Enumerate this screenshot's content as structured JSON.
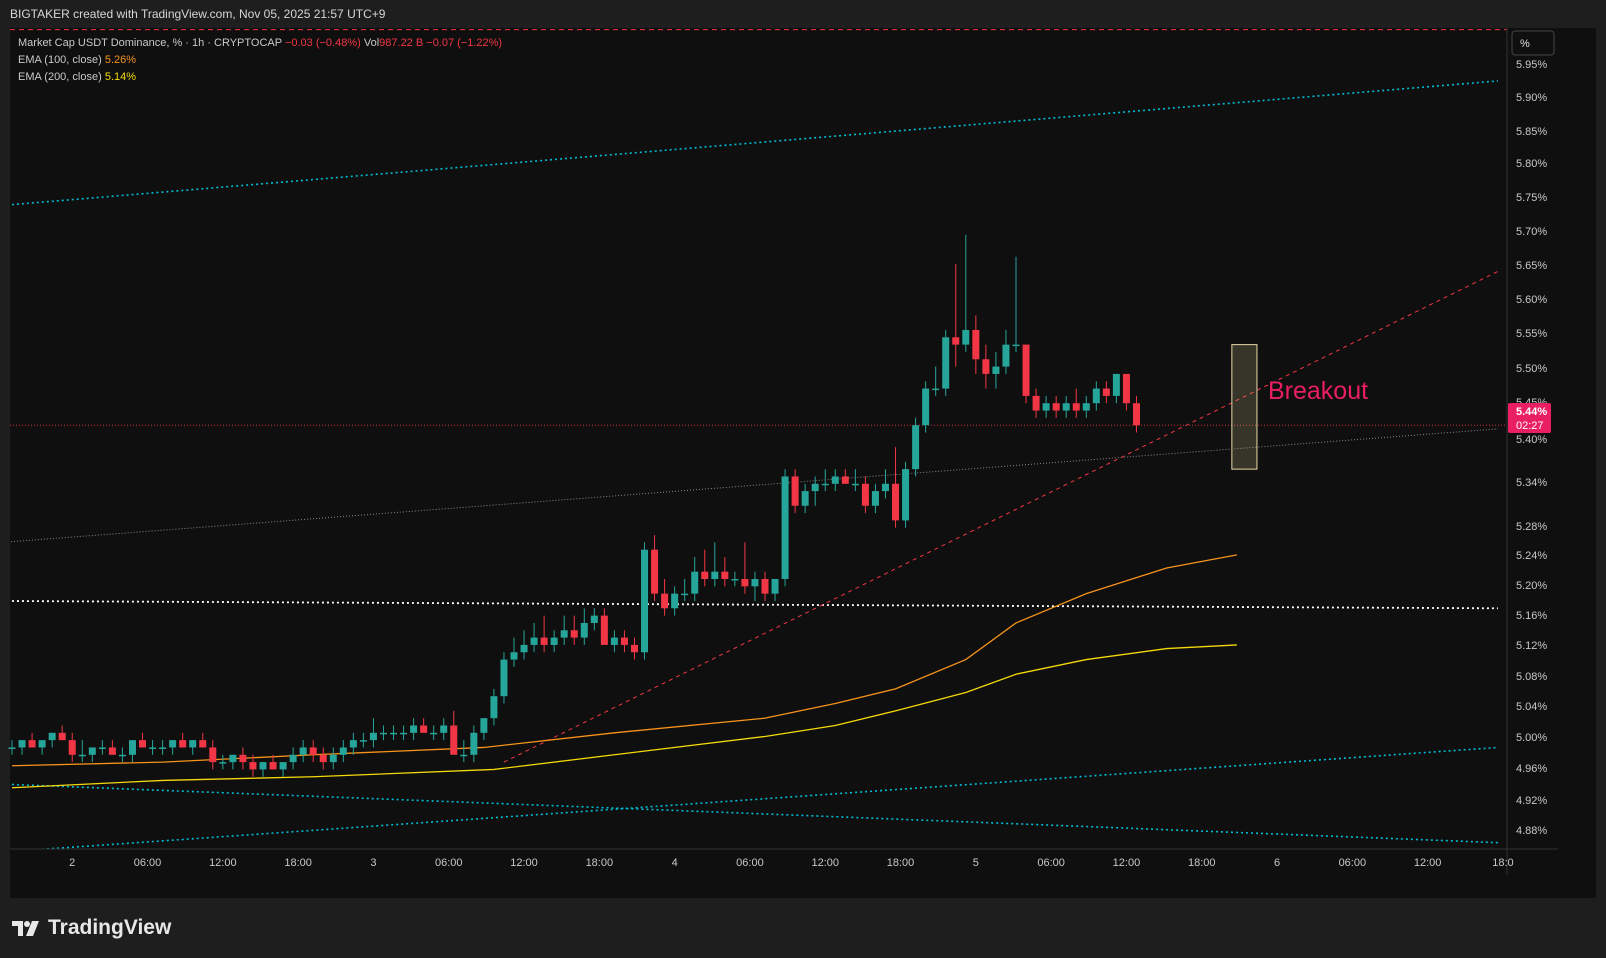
{
  "header": {
    "attribution": "BIGTAKER created with TradingView.com, Nov 05, 2025 21:57 UTC+9"
  },
  "legend": {
    "symbol": "Market Cap USDT Dominance, % · 1h · CRYPTOCAP",
    "change": "−0.03 (−0.48%)",
    "vol_label": "Vol",
    "vol_value": "987.22 B",
    "vol_change": "−0.07 (−1.22%)",
    "ema100_label": "EMA (100, close)",
    "ema100_value": "5.26%",
    "ema200_label": "EMA (200, close)",
    "ema200_value": "5.14%"
  },
  "colors": {
    "up": "#26a69a",
    "down": "#f23645",
    "ema100": "#f7931a",
    "ema200": "#f5d90a",
    "channel": "#00bcd4",
    "label": "#e91e63"
  },
  "price_axis": {
    "unit_label": "%",
    "ticks": [
      "5.95%",
      "5.90%",
      "5.85%",
      "5.80%",
      "5.75%",
      "5.70%",
      "5.65%",
      "5.60%",
      "5.55%",
      "5.50%",
      "5.45%",
      "5.40%",
      "5.34%",
      "5.28%",
      "5.24%",
      "5.20%",
      "5.16%",
      "5.12%",
      "5.08%",
      "5.04%",
      "5.00%",
      "4.96%",
      "4.92%",
      "4.88%"
    ],
    "current_price": "5.44%",
    "countdown": "02:27"
  },
  "time_axis": {
    "ticks": [
      "2",
      "06:00",
      "12:00",
      "18:00",
      "3",
      "06:00",
      "12:00",
      "18:00",
      "4",
      "06:00",
      "12:00",
      "18:00",
      "5",
      "06:00",
      "12:00",
      "18:00",
      "6",
      "06:00",
      "12:00",
      "18:0"
    ]
  },
  "annotation": {
    "text": "Breakout"
  },
  "brand": {
    "name": "TradingView"
  },
  "chart_data": {
    "type": "candlestick",
    "timeframe": "1h",
    "candles": [
      [
        5.0,
        5.01,
        4.99,
        5.0
      ],
      [
        5.0,
        5.01,
        4.99,
        5.01
      ],
      [
        5.01,
        5.02,
        5.0,
        5.0
      ],
      [
        5.0,
        5.01,
        4.99,
        5.01
      ],
      [
        5.01,
        5.02,
        5.0,
        5.02
      ],
      [
        5.02,
        5.03,
        5.01,
        5.01
      ],
      [
        5.01,
        5.02,
        4.98,
        4.99
      ],
      [
        4.99,
        5.01,
        4.98,
        4.99
      ],
      [
        4.99,
        5.0,
        4.98,
        5.0
      ],
      [
        5.0,
        5.01,
        4.99,
        5.0
      ],
      [
        5.0,
        5.01,
        4.99,
        4.99
      ],
      [
        4.99,
        5.0,
        4.98,
        4.99
      ],
      [
        4.99,
        5.01,
        4.98,
        5.01
      ],
      [
        5.01,
        5.02,
        5.0,
        5.0
      ],
      [
        5.0,
        5.01,
        4.99,
        5.0
      ],
      [
        5.0,
        5.01,
        4.99,
        5.0
      ],
      [
        5.0,
        5.01,
        4.99,
        5.01
      ],
      [
        5.01,
        5.02,
        5.0,
        5.0
      ],
      [
        5.0,
        5.01,
        4.99,
        5.01
      ],
      [
        5.01,
        5.02,
        5.0,
        5.0
      ],
      [
        5.0,
        5.01,
        4.97,
        4.98
      ],
      [
        4.98,
        4.99,
        4.97,
        4.98
      ],
      [
        4.98,
        4.99,
        4.97,
        4.99
      ],
      [
        4.99,
        5.0,
        4.97,
        4.98
      ],
      [
        4.98,
        4.99,
        4.96,
        4.97
      ],
      [
        4.97,
        4.98,
        4.96,
        4.98
      ],
      [
        4.98,
        4.99,
        4.97,
        4.97
      ],
      [
        4.97,
        4.98,
        4.96,
        4.98
      ],
      [
        4.98,
        5.0,
        4.97,
        4.99
      ],
      [
        4.99,
        5.01,
        4.98,
        5.0
      ],
      [
        5.0,
        5.01,
        4.98,
        4.99
      ],
      [
        4.99,
        5.0,
        4.97,
        4.98
      ],
      [
        4.98,
        5.0,
        4.97,
        4.99
      ],
      [
        4.99,
        5.01,
        4.98,
        5.0
      ],
      [
        5.0,
        5.02,
        4.99,
        5.01
      ],
      [
        5.01,
        5.02,
        5.0,
        5.01
      ],
      [
        5.01,
        5.04,
        5.0,
        5.02
      ],
      [
        5.02,
        5.03,
        5.01,
        5.02
      ],
      [
        5.02,
        5.03,
        5.01,
        5.02
      ],
      [
        5.02,
        5.03,
        5.01,
        5.02
      ],
      [
        5.02,
        5.04,
        5.01,
        5.03
      ],
      [
        5.03,
        5.04,
        5.02,
        5.02
      ],
      [
        5.02,
        5.03,
        5.01,
        5.02
      ],
      [
        5.02,
        5.04,
        5.01,
        5.03
      ],
      [
        5.03,
        5.05,
        5.02,
        4.99
      ],
      [
        4.99,
        5.01,
        4.98,
        4.99
      ],
      [
        4.99,
        5.03,
        4.98,
        5.02
      ],
      [
        5.02,
        5.04,
        5.01,
        5.04
      ],
      [
        5.04,
        5.08,
        5.03,
        5.07
      ],
      [
        5.07,
        5.13,
        5.06,
        5.12
      ],
      [
        5.12,
        5.15,
        5.11,
        5.13
      ],
      [
        5.13,
        5.16,
        5.12,
        5.14
      ],
      [
        5.14,
        5.17,
        5.13,
        5.15
      ],
      [
        5.15,
        5.18,
        5.13,
        5.14
      ],
      [
        5.14,
        5.16,
        5.13,
        5.15
      ],
      [
        5.15,
        5.18,
        5.14,
        5.16
      ],
      [
        5.16,
        5.18,
        5.14,
        5.15
      ],
      [
        5.15,
        5.19,
        5.14,
        5.17
      ],
      [
        5.17,
        5.19,
        5.16,
        5.18
      ],
      [
        5.18,
        5.19,
        5.16,
        5.14
      ],
      [
        5.14,
        5.16,
        5.13,
        5.15
      ],
      [
        5.15,
        5.16,
        5.13,
        5.14
      ],
      [
        5.14,
        5.15,
        5.12,
        5.13
      ],
      [
        5.13,
        5.28,
        5.12,
        5.27
      ],
      [
        5.27,
        5.29,
        5.2,
        5.21
      ],
      [
        5.21,
        5.23,
        5.18,
        5.19
      ],
      [
        5.19,
        5.22,
        5.18,
        5.21
      ],
      [
        5.21,
        5.23,
        5.2,
        5.21
      ],
      [
        5.21,
        5.26,
        5.2,
        5.24
      ],
      [
        5.24,
        5.27,
        5.22,
        5.23
      ],
      [
        5.23,
        5.28,
        5.22,
        5.24
      ],
      [
        5.24,
        5.26,
        5.22,
        5.23
      ],
      [
        5.23,
        5.24,
        5.22,
        5.23
      ],
      [
        5.23,
        5.28,
        5.21,
        5.22
      ],
      [
        5.22,
        5.24,
        5.2,
        5.23
      ],
      [
        5.23,
        5.24,
        5.2,
        5.21
      ],
      [
        5.21,
        5.23,
        5.2,
        5.23
      ],
      [
        5.23,
        5.38,
        5.22,
        5.37
      ],
      [
        5.37,
        5.38,
        5.32,
        5.33
      ],
      [
        5.33,
        5.36,
        5.32,
        5.35
      ],
      [
        5.35,
        5.37,
        5.33,
        5.36
      ],
      [
        5.36,
        5.38,
        5.35,
        5.36
      ],
      [
        5.36,
        5.38,
        5.35,
        5.37
      ],
      [
        5.37,
        5.38,
        5.36,
        5.36
      ],
      [
        5.36,
        5.38,
        5.35,
        5.36
      ],
      [
        5.36,
        5.37,
        5.32,
        5.33
      ],
      [
        5.33,
        5.36,
        5.32,
        5.35
      ],
      [
        5.35,
        5.38,
        5.34,
        5.36
      ],
      [
        5.36,
        5.41,
        5.3,
        5.31
      ],
      [
        5.31,
        5.39,
        5.3,
        5.38
      ],
      [
        5.38,
        5.45,
        5.37,
        5.44
      ],
      [
        5.44,
        5.5,
        5.43,
        5.49
      ],
      [
        5.49,
        5.52,
        5.48,
        5.49
      ],
      [
        5.49,
        5.57,
        5.48,
        5.56
      ],
      [
        5.56,
        5.66,
        5.52,
        5.55
      ],
      [
        5.55,
        5.7,
        5.54,
        5.57
      ],
      [
        5.57,
        5.59,
        5.51,
        5.53
      ],
      [
        5.53,
        5.55,
        5.49,
        5.51
      ],
      [
        5.51,
        5.54,
        5.49,
        5.52
      ],
      [
        5.52,
        5.57,
        5.51,
        5.55
      ],
      [
        5.55,
        5.67,
        5.54,
        5.55
      ],
      [
        5.55,
        5.55,
        5.47,
        5.48
      ],
      [
        5.48,
        5.49,
        5.45,
        5.46
      ],
      [
        5.46,
        5.48,
        5.45,
        5.47
      ],
      [
        5.47,
        5.48,
        5.45,
        5.46
      ],
      [
        5.46,
        5.48,
        5.45,
        5.47
      ],
      [
        5.47,
        5.49,
        5.45,
        5.46
      ],
      [
        5.46,
        5.48,
        5.45,
        5.47
      ],
      [
        5.47,
        5.5,
        5.46,
        5.49
      ],
      [
        5.49,
        5.5,
        5.47,
        5.48
      ],
      [
        5.48,
        5.51,
        5.47,
        5.51
      ],
      [
        5.51,
        5.51,
        5.46,
        5.47
      ],
      [
        5.47,
        5.48,
        5.43,
        5.44
      ]
    ],
    "ema100": [
      [
        0,
        4.975
      ],
      [
        15,
        4.98
      ],
      [
        30,
        4.99
      ],
      [
        47,
        5.0
      ],
      [
        60,
        5.02
      ],
      [
        75,
        5.04
      ],
      [
        82,
        5.06
      ],
      [
        88,
        5.08
      ],
      [
        95,
        5.12
      ],
      [
        100,
        5.17
      ],
      [
        107,
        5.21
      ],
      [
        115,
        5.245
      ],
      [
        122,
        5.263
      ]
    ],
    "ema200": [
      [
        0,
        4.945
      ],
      [
        15,
        4.955
      ],
      [
        30,
        4.96
      ],
      [
        48,
        4.97
      ],
      [
        60,
        4.99
      ],
      [
        75,
        5.015
      ],
      [
        82,
        5.03
      ],
      [
        88,
        5.05
      ],
      [
        95,
        5.075
      ],
      [
        100,
        5.1
      ],
      [
        107,
        5.12
      ],
      [
        115,
        5.135
      ],
      [
        122,
        5.14
      ]
    ],
    "lines": {
      "upper_channel": [
        [
          -1,
          5.74
        ],
        [
          148,
          5.91
        ]
      ],
      "lower_channel_rising": [
        [
          2,
          4.86
        ],
        [
          148,
          5.0
        ]
      ],
      "lower_channel_falling": [
        [
          -1,
          4.95
        ],
        [
          148,
          4.87
        ]
      ],
      "mid_gray": [
        [
          -1,
          5.28
        ],
        [
          148,
          5.435
        ]
      ],
      "horizontal_support": [
        [
          -1,
          5.2
        ],
        [
          148,
          5.19
        ]
      ],
      "breakout_trendline": [
        [
          49,
          4.98
        ],
        [
          148,
          5.65
        ]
      ],
      "current_price_line": 5.44,
      "upper_red_dashed": 5.98
    },
    "highlight_box": {
      "x_from": 121.5,
      "x_to": 124,
      "y_from": 5.38,
      "y_to": 5.55
    },
    "x_ticks": [
      6,
      13.5,
      21,
      28.5,
      36,
      43.5,
      51,
      58.5,
      66,
      73.5,
      81,
      88.5,
      96,
      103.5,
      111,
      118.5,
      126,
      133.5,
      141,
      148.5
    ],
    "ylim": [
      4.86,
      5.98
    ]
  }
}
